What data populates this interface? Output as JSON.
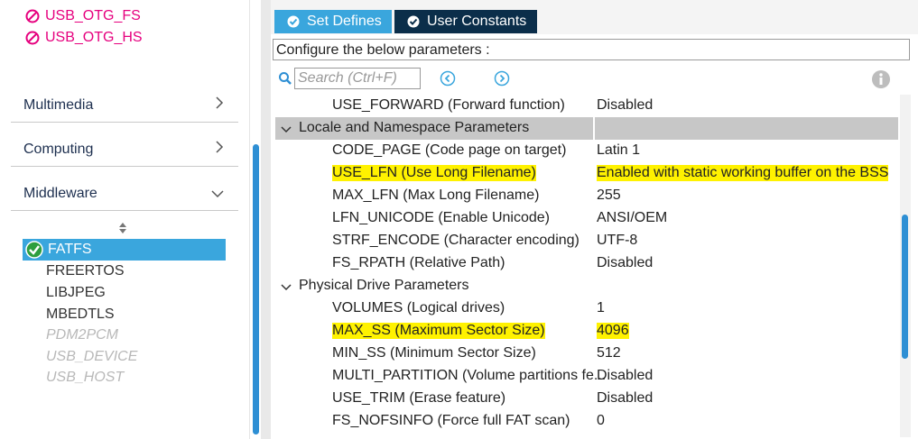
{
  "left_panel": {
    "usb_items": [
      "USB_OTG_FS",
      "USB_OTG_HS"
    ],
    "categories": [
      {
        "label": "Multimedia",
        "chevron": "chevron-right"
      },
      {
        "label": "Computing",
        "chevron": "chevron-right"
      },
      {
        "label": "Middleware",
        "chevron": "chevron-down"
      }
    ],
    "middleware_items": [
      {
        "label": "FATFS",
        "state": "selected-enabled"
      },
      {
        "label": "FREERTOS",
        "state": "available"
      },
      {
        "label": "LIBJPEG",
        "state": "available"
      },
      {
        "label": "MBEDTLS",
        "state": "available"
      },
      {
        "label": "PDM2PCM",
        "state": "disabled"
      },
      {
        "label": "USB_DEVICE",
        "state": "disabled"
      },
      {
        "label": "USB_HOST",
        "state": "disabled"
      }
    ]
  },
  "tabs": [
    {
      "label": "Set Defines",
      "active": true
    },
    {
      "label": "User Constants",
      "active": false
    }
  ],
  "configure_text": "Configure the below parameters :",
  "search": {
    "placeholder": "Search (Ctrl+F)"
  },
  "grid": {
    "top_row": {
      "name": "USE_FORWARD (Forward function)",
      "value": "Disabled"
    },
    "group_locale": {
      "title": "Locale and Namespace Parameters",
      "rows": [
        {
          "name": "CODE_PAGE (Code page on target)",
          "value": "Latin 1",
          "highlight": false
        },
        {
          "name": "USE_LFN (Use Long Filename)",
          "value": "Enabled with static working buffer on the BSS",
          "highlight": true
        },
        {
          "name": "MAX_LFN (Max Long Filename)",
          "value": "255",
          "highlight": false
        },
        {
          "name": "LFN_UNICODE (Enable Unicode)",
          "value": "ANSI/OEM",
          "highlight": false
        },
        {
          "name": "STRF_ENCODE (Character encoding)",
          "value": "UTF-8",
          "highlight": false
        },
        {
          "name": "FS_RPATH (Relative Path)",
          "value": "Disabled",
          "highlight": false
        }
      ]
    },
    "group_physical": {
      "title": "Physical Drive Parameters",
      "rows": [
        {
          "name": "VOLUMES (Logical drives)",
          "value": "1",
          "highlight": false
        },
        {
          "name": "MAX_SS (Maximum Sector Size)",
          "value": "4096",
          "highlight": true
        },
        {
          "name": "MIN_SS (Minimum Sector Size)",
          "value": "512",
          "highlight": false
        },
        {
          "name": "MULTI_PARTITION (Volume partitions fe...",
          "value": "Disabled",
          "highlight": false
        },
        {
          "name": "USE_TRIM (Erase feature)",
          "value": "Disabled",
          "highlight": false
        },
        {
          "name": "FS_NOFSINFO (Force full FAT scan)",
          "value": "0",
          "highlight": false
        }
      ]
    }
  },
  "colors": {
    "accent_blue": "#3aa6dd",
    "dark_navy": "#0b2e4a",
    "usb_pink": "#e6007e",
    "highlight_yellow": "#fff200",
    "group_gray": "#c7c7c7"
  }
}
